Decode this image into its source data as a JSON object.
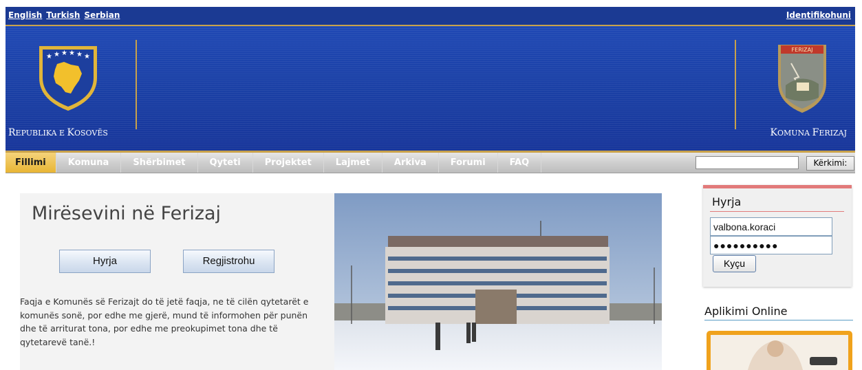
{
  "topbar": {
    "languages": [
      "English",
      "Turkish",
      "Serbian"
    ],
    "login_link": "Identifikohuni"
  },
  "header": {
    "left_title_parts": [
      "R",
      "EPUBLIKA E ",
      "K",
      "OSOVËS"
    ],
    "right_title_parts": [
      "K",
      "OMUNA ",
      "F",
      "ERIZAJ"
    ],
    "right_emblem_label": "FERIZAJ"
  },
  "nav": {
    "items": [
      "Fillimi",
      "Komuna",
      "Shërbimet",
      "Qyteti",
      "Projektet",
      "Lajmet",
      "Arkiva",
      "Forumi",
      "FAQ"
    ],
    "active_index": 0,
    "search_value": "",
    "search_button": "Kërkimi:"
  },
  "welcome": {
    "title": "Mirësevini në Ferizaj",
    "login_button": "Hyrja",
    "register_button": "Regjistrohu",
    "text": "Faqja e Komunës së Ferizajt do të jetë faqja, ne të cilën qytetarët e komunës sonë, por edhe me gjerë, mund të informohen për punën dhe të arriturat tona, por edhe me preokupimet tona dhe të qytetarevë tanë.!"
  },
  "login_box": {
    "title": "Hyrja",
    "username_value": "valbona.koraci",
    "password_value": "●●●●●●●●●●",
    "submit_label": "Kyçu"
  },
  "sidebar": {
    "aplikimi_title": "Aplikimi Online"
  },
  "colors": {
    "header_blue": "#1a3fa4",
    "gold": "#c9a24a",
    "nav_active": "#e8b534",
    "login_accent": "#e27a7a"
  }
}
